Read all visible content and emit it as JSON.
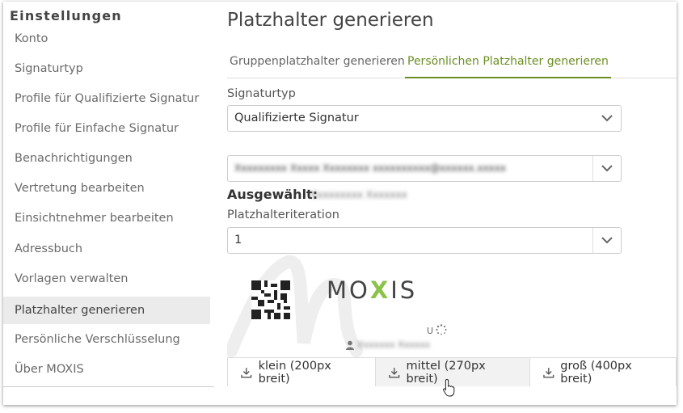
{
  "sidebar": {
    "title": "Einstellungen",
    "items": [
      {
        "label": "Konto"
      },
      {
        "label": "Signaturtyp"
      },
      {
        "label": "Profile für Qualifizierte Signatur"
      },
      {
        "label": "Profile für Einfache Signatur"
      },
      {
        "label": "Benachrichtigungen"
      },
      {
        "label": "Vertretung bearbeiten"
      },
      {
        "label": "Einsichtnehmer bearbeiten"
      },
      {
        "label": "Adressbuch"
      },
      {
        "label": "Vorlagen verwalten"
      },
      {
        "label": "Platzhalter generieren",
        "active": true
      },
      {
        "label": "Persönliche Verschlüsselung"
      },
      {
        "label": "Über MOXIS"
      }
    ]
  },
  "main": {
    "title": "Platzhalter generieren",
    "tabs": [
      {
        "label": "Gruppenplatzhalter generieren",
        "active": false
      },
      {
        "label": "Persönlichen Platzhalter generieren",
        "active": true
      }
    ],
    "signaturtyp_label": "Signaturtyp",
    "signaturtyp_value": "Qualifizierte Signatur",
    "profile_value": "Xxxxxxxxx Xxxxx Xxxxxxxx xxxxxxxxxx@xxxxxx.xxxxx",
    "selected_label": "Ausgewählt:",
    "selected_value": "Xxxxxxxxx Xxxxxxx",
    "iteration_label": "Platzhalteriteration",
    "iteration_value": "1",
    "preview": {
      "logo_text": "MOXIS",
      "u_mark": "U",
      "person_name": "Xxxxxxx Xxxxxx"
    },
    "downloads": [
      {
        "label": "klein (200px breit)"
      },
      {
        "label": "mittel (270px breit)"
      },
      {
        "label": "groß (400px breit)"
      }
    ]
  },
  "colors": {
    "accent": "#6b8e23",
    "active_item_bg": "#ebebeb",
    "logo_x": "#8bc34a"
  }
}
